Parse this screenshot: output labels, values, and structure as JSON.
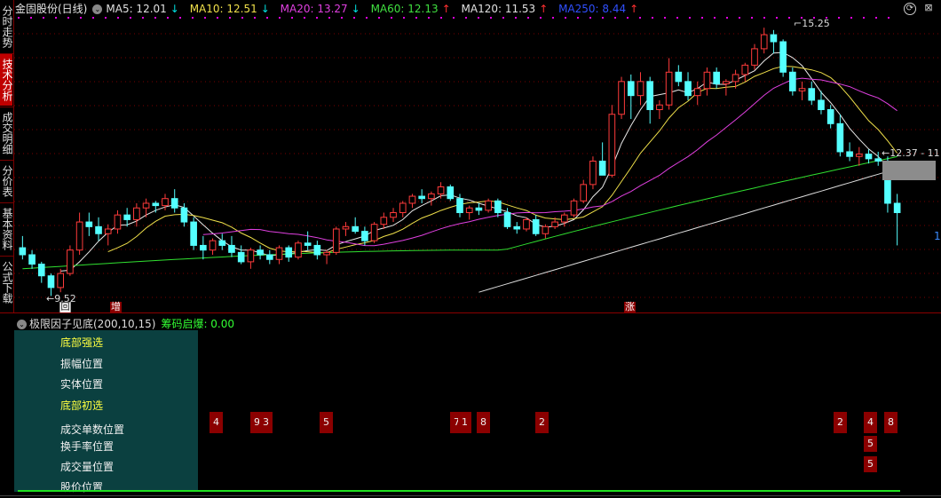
{
  "side_tabs": [
    "分时走势",
    "技术分析",
    "成交明细",
    "分价表",
    "基本资料",
    "公式下载"
  ],
  "header": {
    "title": "金固股份(日线)",
    "ma": [
      {
        "label": "MA5: 12.01",
        "arrow": "↓",
        "color": "#e0e0e0",
        "arrow_dir": "down"
      },
      {
        "label": "MA10: 12.51",
        "arrow": "↓",
        "color": "#f0e04a",
        "arrow_dir": "down"
      },
      {
        "label": "MA20: 13.27",
        "arrow": "↓",
        "color": "#e040e0",
        "arrow_dir": "down"
      },
      {
        "label": "MA60: 12.13",
        "arrow": "↑",
        "color": "#40e040",
        "arrow_dir": "up"
      },
      {
        "label": "MA120: 11.53",
        "arrow": "↑",
        "color": "#e0e0e0",
        "arrow_dir": "up"
      },
      {
        "label": "MA250: 8.44",
        "arrow": "↑",
        "color": "#3050ff",
        "arrow_dir": "up"
      }
    ]
  },
  "annotations": {
    "high": "15.25",
    "low": "9.52",
    "price_tag": "12.37 - 11",
    "right_edge": "1",
    "marker_hui": "回",
    "marker_zeng": "增",
    "marker_zhang": "涨"
  },
  "indicator": {
    "title": "极限因子见底(200,10,15)",
    "extra": "筹码启爆: 0.00",
    "rows": [
      {
        "label": "底部强选",
        "style": "yellow"
      },
      {
        "label": "振幅位置",
        "style": "white"
      },
      {
        "label": "实体位置",
        "style": "white"
      },
      {
        "label": "底部初选",
        "style": "yellow"
      },
      {
        "label": "成交单数位置",
        "style": "white"
      },
      {
        "label": "换手率位置",
        "style": "white"
      },
      {
        "label": "成交量位置",
        "style": "white"
      },
      {
        "label": "股价位置",
        "style": "white"
      }
    ],
    "signals_row1": [
      "4",
      "9",
      "3",
      "5",
      "7",
      "1",
      "8",
      "2",
      "2",
      "4",
      "8"
    ],
    "signals_row2": [
      "5"
    ],
    "signals_row3": [
      "5"
    ]
  },
  "colors": {
    "up": "#ff3b3b",
    "down": "#54ffff",
    "bg": "#000000",
    "accent": "#c00000"
  },
  "chart_data": {
    "type": "candlestick",
    "title": "金固股份(日线)",
    "ohlc": [
      [
        10.55,
        10.8,
        10.3,
        10.4
      ],
      [
        10.4,
        10.5,
        10.1,
        10.2
      ],
      [
        10.2,
        10.25,
        9.8,
        9.95
      ],
      [
        9.95,
        10.0,
        9.52,
        9.7
      ],
      [
        9.7,
        10.1,
        9.6,
        10.0
      ],
      [
        10.0,
        10.6,
        9.95,
        10.5
      ],
      [
        10.5,
        11.3,
        10.4,
        11.1
      ],
      [
        11.1,
        11.3,
        10.8,
        11.0
      ],
      [
        11.0,
        11.2,
        10.7,
        10.85
      ],
      [
        10.85,
        11.05,
        10.6,
        10.95
      ],
      [
        10.95,
        11.35,
        10.85,
        11.25
      ],
      [
        11.25,
        11.4,
        11.0,
        11.15
      ],
      [
        11.15,
        11.5,
        11.0,
        11.4
      ],
      [
        11.4,
        11.6,
        11.2,
        11.5
      ],
      [
        11.5,
        11.55,
        11.3,
        11.45
      ],
      [
        11.45,
        11.7,
        11.35,
        11.6
      ],
      [
        11.6,
        11.8,
        11.3,
        11.4
      ],
      [
        11.4,
        11.5,
        11.0,
        11.1
      ],
      [
        11.1,
        11.2,
        10.5,
        10.6
      ],
      [
        10.6,
        10.8,
        10.3,
        10.5
      ],
      [
        10.5,
        10.75,
        10.4,
        10.7
      ],
      [
        10.7,
        10.85,
        10.5,
        10.6
      ],
      [
        10.6,
        10.8,
        10.35,
        10.45
      ],
      [
        10.45,
        10.6,
        10.2,
        10.25
      ],
      [
        10.25,
        10.55,
        10.1,
        10.5
      ],
      [
        10.5,
        10.6,
        10.3,
        10.4
      ],
      [
        10.4,
        10.5,
        10.2,
        10.3
      ],
      [
        10.3,
        10.6,
        10.2,
        10.55
      ],
      [
        10.55,
        10.6,
        10.25,
        10.35
      ],
      [
        10.35,
        10.7,
        10.3,
        10.65
      ],
      [
        10.65,
        10.9,
        10.5,
        10.6
      ],
      [
        10.6,
        10.7,
        10.3,
        10.4
      ],
      [
        10.4,
        10.5,
        10.2,
        10.45
      ],
      [
        10.45,
        11.0,
        10.4,
        10.95
      ],
      [
        10.95,
        11.1,
        10.8,
        11.0
      ],
      [
        11.0,
        11.2,
        10.85,
        10.9
      ],
      [
        10.9,
        11.0,
        10.6,
        10.7
      ],
      [
        10.7,
        11.1,
        10.65,
        11.05
      ],
      [
        11.05,
        11.3,
        10.95,
        11.2
      ],
      [
        11.2,
        11.4,
        11.1,
        11.3
      ],
      [
        11.3,
        11.55,
        11.2,
        11.5
      ],
      [
        11.5,
        11.7,
        11.4,
        11.65
      ],
      [
        11.65,
        11.8,
        11.5,
        11.6
      ],
      [
        11.6,
        11.75,
        11.45,
        11.7
      ],
      [
        11.7,
        11.95,
        11.6,
        11.85
      ],
      [
        11.85,
        11.9,
        11.55,
        11.6
      ],
      [
        11.6,
        11.7,
        11.2,
        11.3
      ],
      [
        11.3,
        11.45,
        11.15,
        11.4
      ],
      [
        11.4,
        11.5,
        11.25,
        11.35
      ],
      [
        11.35,
        11.6,
        11.3,
        11.55
      ],
      [
        11.55,
        11.6,
        11.2,
        11.3
      ],
      [
        11.3,
        11.4,
        10.95,
        11.0
      ],
      [
        11.0,
        11.1,
        10.85,
        10.95
      ],
      [
        10.95,
        11.2,
        10.9,
        11.15
      ],
      [
        11.15,
        11.25,
        10.8,
        10.85
      ],
      [
        10.85,
        11.05,
        10.75,
        11.0
      ],
      [
        11.0,
        11.2,
        10.95,
        11.1
      ],
      [
        11.1,
        11.3,
        11.0,
        11.25
      ],
      [
        11.25,
        11.6,
        11.2,
        11.55
      ],
      [
        11.55,
        12.0,
        11.5,
        11.9
      ],
      [
        11.9,
        12.5,
        11.8,
        12.4
      ],
      [
        12.4,
        12.8,
        12.3,
        12.1
      ],
      [
        12.1,
        13.6,
        12.05,
        13.4
      ],
      [
        13.4,
        14.2,
        13.3,
        14.1
      ],
      [
        14.1,
        14.25,
        13.3,
        13.8
      ],
      [
        13.8,
        14.3,
        13.6,
        14.1
      ],
      [
        14.1,
        14.2,
        13.2,
        13.5
      ],
      [
        13.5,
        13.7,
        13.3,
        13.6
      ],
      [
        13.6,
        14.6,
        13.5,
        14.3
      ],
      [
        14.3,
        14.45,
        14.0,
        14.1
      ],
      [
        14.1,
        14.3,
        13.7,
        13.8
      ],
      [
        13.8,
        14.1,
        13.6,
        13.95
      ],
      [
        13.95,
        14.4,
        13.8,
        14.3
      ],
      [
        14.3,
        14.4,
        13.95,
        14.05
      ],
      [
        14.05,
        14.15,
        13.8,
        14.1
      ],
      [
        14.1,
        14.35,
        13.95,
        14.25
      ],
      [
        14.25,
        14.5,
        14.1,
        14.45
      ],
      [
        14.45,
        14.9,
        14.35,
        14.8
      ],
      [
        14.8,
        15.25,
        14.7,
        15.1
      ],
      [
        15.1,
        15.2,
        14.7,
        14.95
      ],
      [
        14.95,
        15.0,
        14.2,
        14.3
      ],
      [
        14.3,
        14.4,
        13.8,
        13.9
      ],
      [
        13.9,
        14.1,
        13.7,
        13.95
      ],
      [
        13.95,
        14.1,
        13.6,
        13.7
      ],
      [
        13.7,
        13.9,
        13.4,
        13.5
      ],
      [
        13.5,
        13.6,
        13.1,
        13.2
      ],
      [
        13.2,
        13.4,
        12.5,
        12.6
      ],
      [
        12.6,
        12.8,
        12.4,
        12.5
      ],
      [
        12.5,
        12.7,
        12.3,
        12.55
      ],
      [
        12.55,
        12.65,
        12.35,
        12.45
      ],
      [
        12.45,
        12.6,
        12.3,
        12.4
      ],
      [
        12.4,
        12.5,
        11.3,
        11.5
      ],
      [
        11.5,
        11.7,
        10.6,
        11.3
      ]
    ]
  }
}
